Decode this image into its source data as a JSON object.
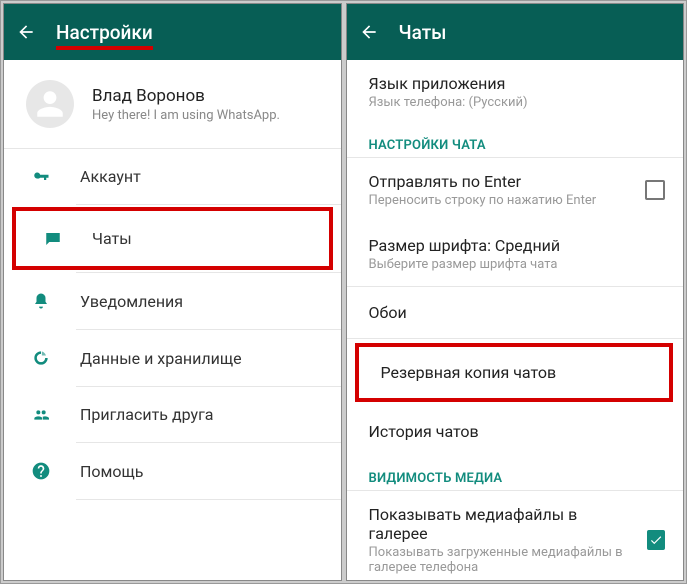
{
  "left": {
    "title": "Настройки",
    "profile": {
      "name": "Влад Воронов",
      "status": "Hey there! I am using WhatsApp."
    },
    "menu": {
      "account": "Аккаунт",
      "chats": "Чаты",
      "notifications": "Уведомления",
      "data": "Данные и хранилище",
      "invite": "Пригласить друга",
      "help": "Помощь"
    }
  },
  "right": {
    "title": "Чаты",
    "lang": {
      "primary": "Язык приложения",
      "secondary": "Язык телефона: (Русский)"
    },
    "section_chat": "НАСТРОЙКИ ЧАТА",
    "enter": {
      "primary": "Отправлять по Enter",
      "secondary": "Переносить строку по нажатию Enter"
    },
    "font": {
      "primary": "Размер шрифта: Средний",
      "secondary": "Выберите размер шрифта чата"
    },
    "wallpaper": "Обои",
    "backup": "Резервная копия чатов",
    "history": "История чатов",
    "section_media": "ВИДИМОСТЬ МЕДИА",
    "media": {
      "primary": "Показывать медиафайлы в галерее",
      "secondary": "Показывать загруженные медиафайлы в галерее телефона"
    }
  }
}
